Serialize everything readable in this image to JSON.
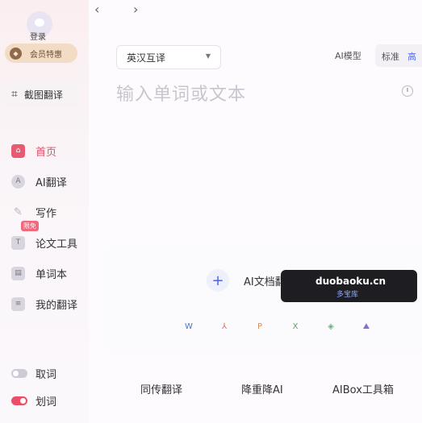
{
  "user": {
    "login_label": "登录",
    "member_label": "会员特惠"
  },
  "screenshot_translate": {
    "label": "截图翻译"
  },
  "nav": {
    "items": [
      {
        "label": "首页",
        "icon": "home-icon",
        "color": "#e85a74"
      },
      {
        "label": "AI翻译",
        "icon": "ai-translate-icon",
        "color": "#b8b4bf"
      },
      {
        "label": "写作",
        "icon": "pen-icon",
        "color": "#b8b4bf"
      },
      {
        "label": "论文工具",
        "icon": "paper-tool-icon",
        "color": "#b8b4bf",
        "badge": "限免"
      },
      {
        "label": "单词本",
        "icon": "wordbook-icon",
        "color": "#b8b4bf"
      },
      {
        "label": "我的翻译",
        "icon": "my-translation-icon",
        "color": "#b8b4bf"
      }
    ]
  },
  "toggles": [
    {
      "label": "取词",
      "on": false,
      "color": "#cfcbd6"
    },
    {
      "label": "划词",
      "on": true,
      "color": "#ee4d6a"
    }
  ],
  "toolbar": {
    "language_pair": "英汉互译",
    "ai_model_label": "AI模型",
    "mode_standard": "标准",
    "mode_high": "高"
  },
  "input": {
    "placeholder": "输入单词或文本"
  },
  "upload": {
    "label": "AI文档翻译"
  },
  "formats": [
    "W",
    "⅄",
    "P",
    "X",
    "◈",
    "⛰"
  ],
  "watermark": {
    "site": "duobaoku.cn",
    "name": "多宝库"
  },
  "bottom_links": [
    "同传翻译",
    "降重降AI",
    "AIBox工具箱"
  ],
  "colors": {
    "accent": "#e85a74",
    "brand_blue": "#4c63e3"
  }
}
